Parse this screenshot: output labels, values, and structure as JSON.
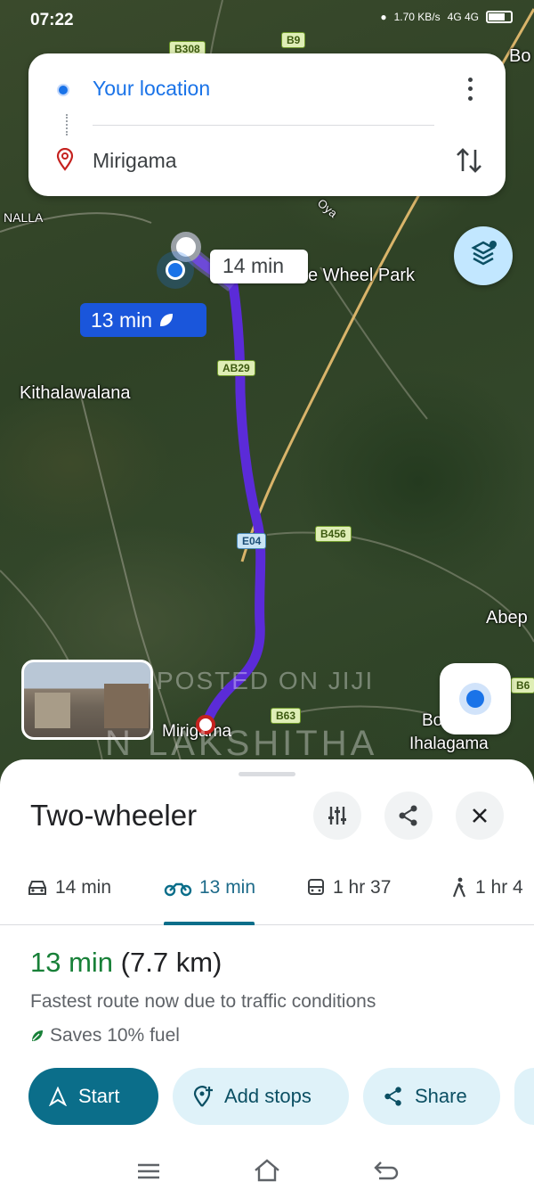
{
  "status": {
    "time": "07:22",
    "net": "1.70 KB/s",
    "signal": "4G 4G"
  },
  "search": {
    "origin": "Your location",
    "destination": "Mirigama"
  },
  "map": {
    "place_labels": {
      "nalla": "NALLA",
      "bo": "Bo",
      "kithalawalana": "Kithalawalana",
      "wheel_park": "e Wheel Park",
      "abep": "Abep",
      "mirigama": "Mirigama",
      "bo2": "Bo",
      "ihalagama": "Ihalagama",
      "oya": "Oya"
    },
    "shields": {
      "b308": "B308",
      "b9": "B9",
      "ab29": "AB29",
      "e04": "E04",
      "b456": "B456",
      "b63": "B63",
      "b6": "B6"
    },
    "alt_time": "14 min",
    "main_time": "13 min",
    "watermark_1": "POSTED ON JIJI",
    "watermark_2": "N LAKSHITHA"
  },
  "sheet": {
    "title": "Two-wheeler",
    "modes": [
      {
        "label": "14 min",
        "icon": "car-icon"
      },
      {
        "label": "13 min",
        "icon": "motorcycle-icon"
      },
      {
        "label": "1 hr 37",
        "icon": "transit-icon"
      },
      {
        "label": "1 hr 4",
        "icon": "walk-icon"
      }
    ],
    "eta_time": "13 min",
    "eta_distance": "(7.7 km)",
    "reason": "Fastest route now due to traffic conditions",
    "fuel": "Saves 10% fuel",
    "actions": {
      "start": "Start",
      "add_stops": "Add stops",
      "share": "Share"
    }
  },
  "colors": {
    "route": "#5b2bd8",
    "accent": "#0b6e8a",
    "eta_green": "#188038",
    "blue": "#1a73e8"
  }
}
